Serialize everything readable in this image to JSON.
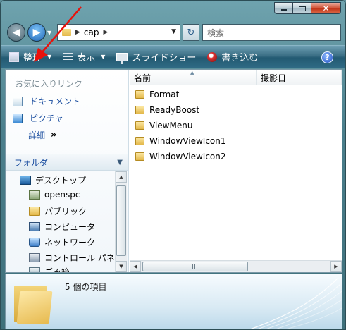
{
  "address": {
    "path_label": "cap",
    "search_placeholder": "検索"
  },
  "toolbar": {
    "organize_label": "整理",
    "views_label": "表示",
    "slideshow_label": "スライドショー",
    "burn_label": "書き込む",
    "help_label": "?"
  },
  "nav_pane": {
    "favorites_title": "お気に入りリンク",
    "favorites": [
      {
        "label": "ドキュメント",
        "icon": "documents-icon"
      },
      {
        "label": "ピクチャ",
        "icon": "pictures-icon"
      }
    ],
    "more_label": "詳細",
    "more_chevron": "»",
    "folders_label": "フォルダ",
    "tree": [
      {
        "label": "デスクトップ",
        "icon": "desktop-icon"
      },
      {
        "label": "openspc",
        "icon": "user-folder-icon"
      },
      {
        "label": "パブリック",
        "icon": "folder-icon"
      },
      {
        "label": "コンピュータ",
        "icon": "computer-icon"
      },
      {
        "label": "ネットワーク",
        "icon": "network-icon"
      },
      {
        "label": "コントロール パネル",
        "icon": "control-panel-icon"
      },
      {
        "label": "ごみ箱",
        "icon": "recycle-bin-icon"
      }
    ]
  },
  "file_list": {
    "columns": [
      "名前",
      "撮影日"
    ],
    "files": [
      "Format",
      "ReadyBoost",
      "ViewMenu",
      "WindowViewIcon1",
      "WindowViewIcon2"
    ]
  },
  "details": {
    "item_count": "5 個の項目"
  },
  "colors": {
    "link": "#1c4fa0",
    "toolbar": "#2f6a84",
    "annotation_arrow": "#e8120c"
  }
}
